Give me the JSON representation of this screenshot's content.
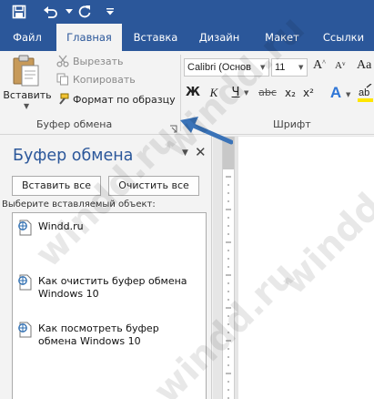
{
  "quick_access": {
    "save_icon": "save-icon",
    "undo_icon": "undo-icon",
    "redo_icon": "redo-icon",
    "customize_icon": "chevron-down-icon"
  },
  "tabs": [
    {
      "label": "Файл"
    },
    {
      "label": "Главная",
      "active": true
    },
    {
      "label": "Вставка"
    },
    {
      "label": "Дизайн"
    },
    {
      "label": "Макет"
    },
    {
      "label": "Ссылки"
    }
  ],
  "clipboard_group": {
    "paste_label": "Вставить",
    "cut_label": "Вырезать",
    "copy_label": "Копировать",
    "format_painter_label": "Формат по образцу",
    "group_label": "Буфер обмена"
  },
  "font_group": {
    "font_name": "Calibri (Основ",
    "font_size": "11",
    "grow_label": "A",
    "shrink_label": "A",
    "case_label": "Aa",
    "bold_label": "Ж",
    "italic_label": "К",
    "underline_label": "Ч",
    "strike_label": "abc",
    "sub_label": "x₂",
    "sup_label": "x²",
    "effects_label": "A",
    "group_label": "Шрифт"
  },
  "pane": {
    "title": "Буфер обмена",
    "paste_all": "Вставить все",
    "clear_all": "Очистить все",
    "select_label": "Выберите вставляемый объект:",
    "items": [
      {
        "text": "Windd.ru"
      },
      {
        "text": "Как очистить буфер обмена\nWindows 10"
      },
      {
        "text": "Как посмотреть буфер\nобмена Windows 10"
      }
    ]
  },
  "watermark": "windd.ru",
  "colors": {
    "accent": "#2b579a",
    "arrow": "#3a73b8"
  }
}
